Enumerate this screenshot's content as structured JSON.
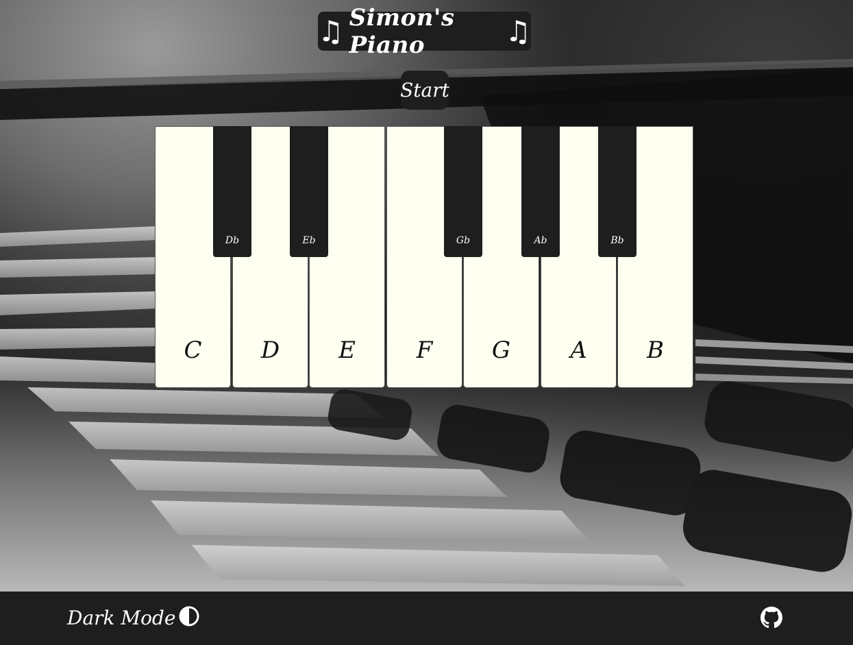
{
  "header": {
    "title": "Simon's Piano",
    "note_glyph": "♫",
    "icon_left": "music-note-icon",
    "icon_right": "music-note-icon"
  },
  "controls": {
    "start_label": "Start"
  },
  "piano": {
    "white_keys": [
      "C",
      "D",
      "E",
      "F",
      "G",
      "A",
      "B"
    ],
    "black_keys": [
      "Db",
      "Eb",
      "Gb",
      "Ab",
      "Bb"
    ]
  },
  "footer": {
    "dark_mode_label": "Dark Mode",
    "dark_mode_icon": "contrast-icon",
    "github_icon": "github-icon"
  },
  "colors": {
    "panel": "#1e1e1e",
    "white_key": "#fefff0",
    "black_key": "#1e1e1e",
    "text_light": "#ffffff"
  }
}
